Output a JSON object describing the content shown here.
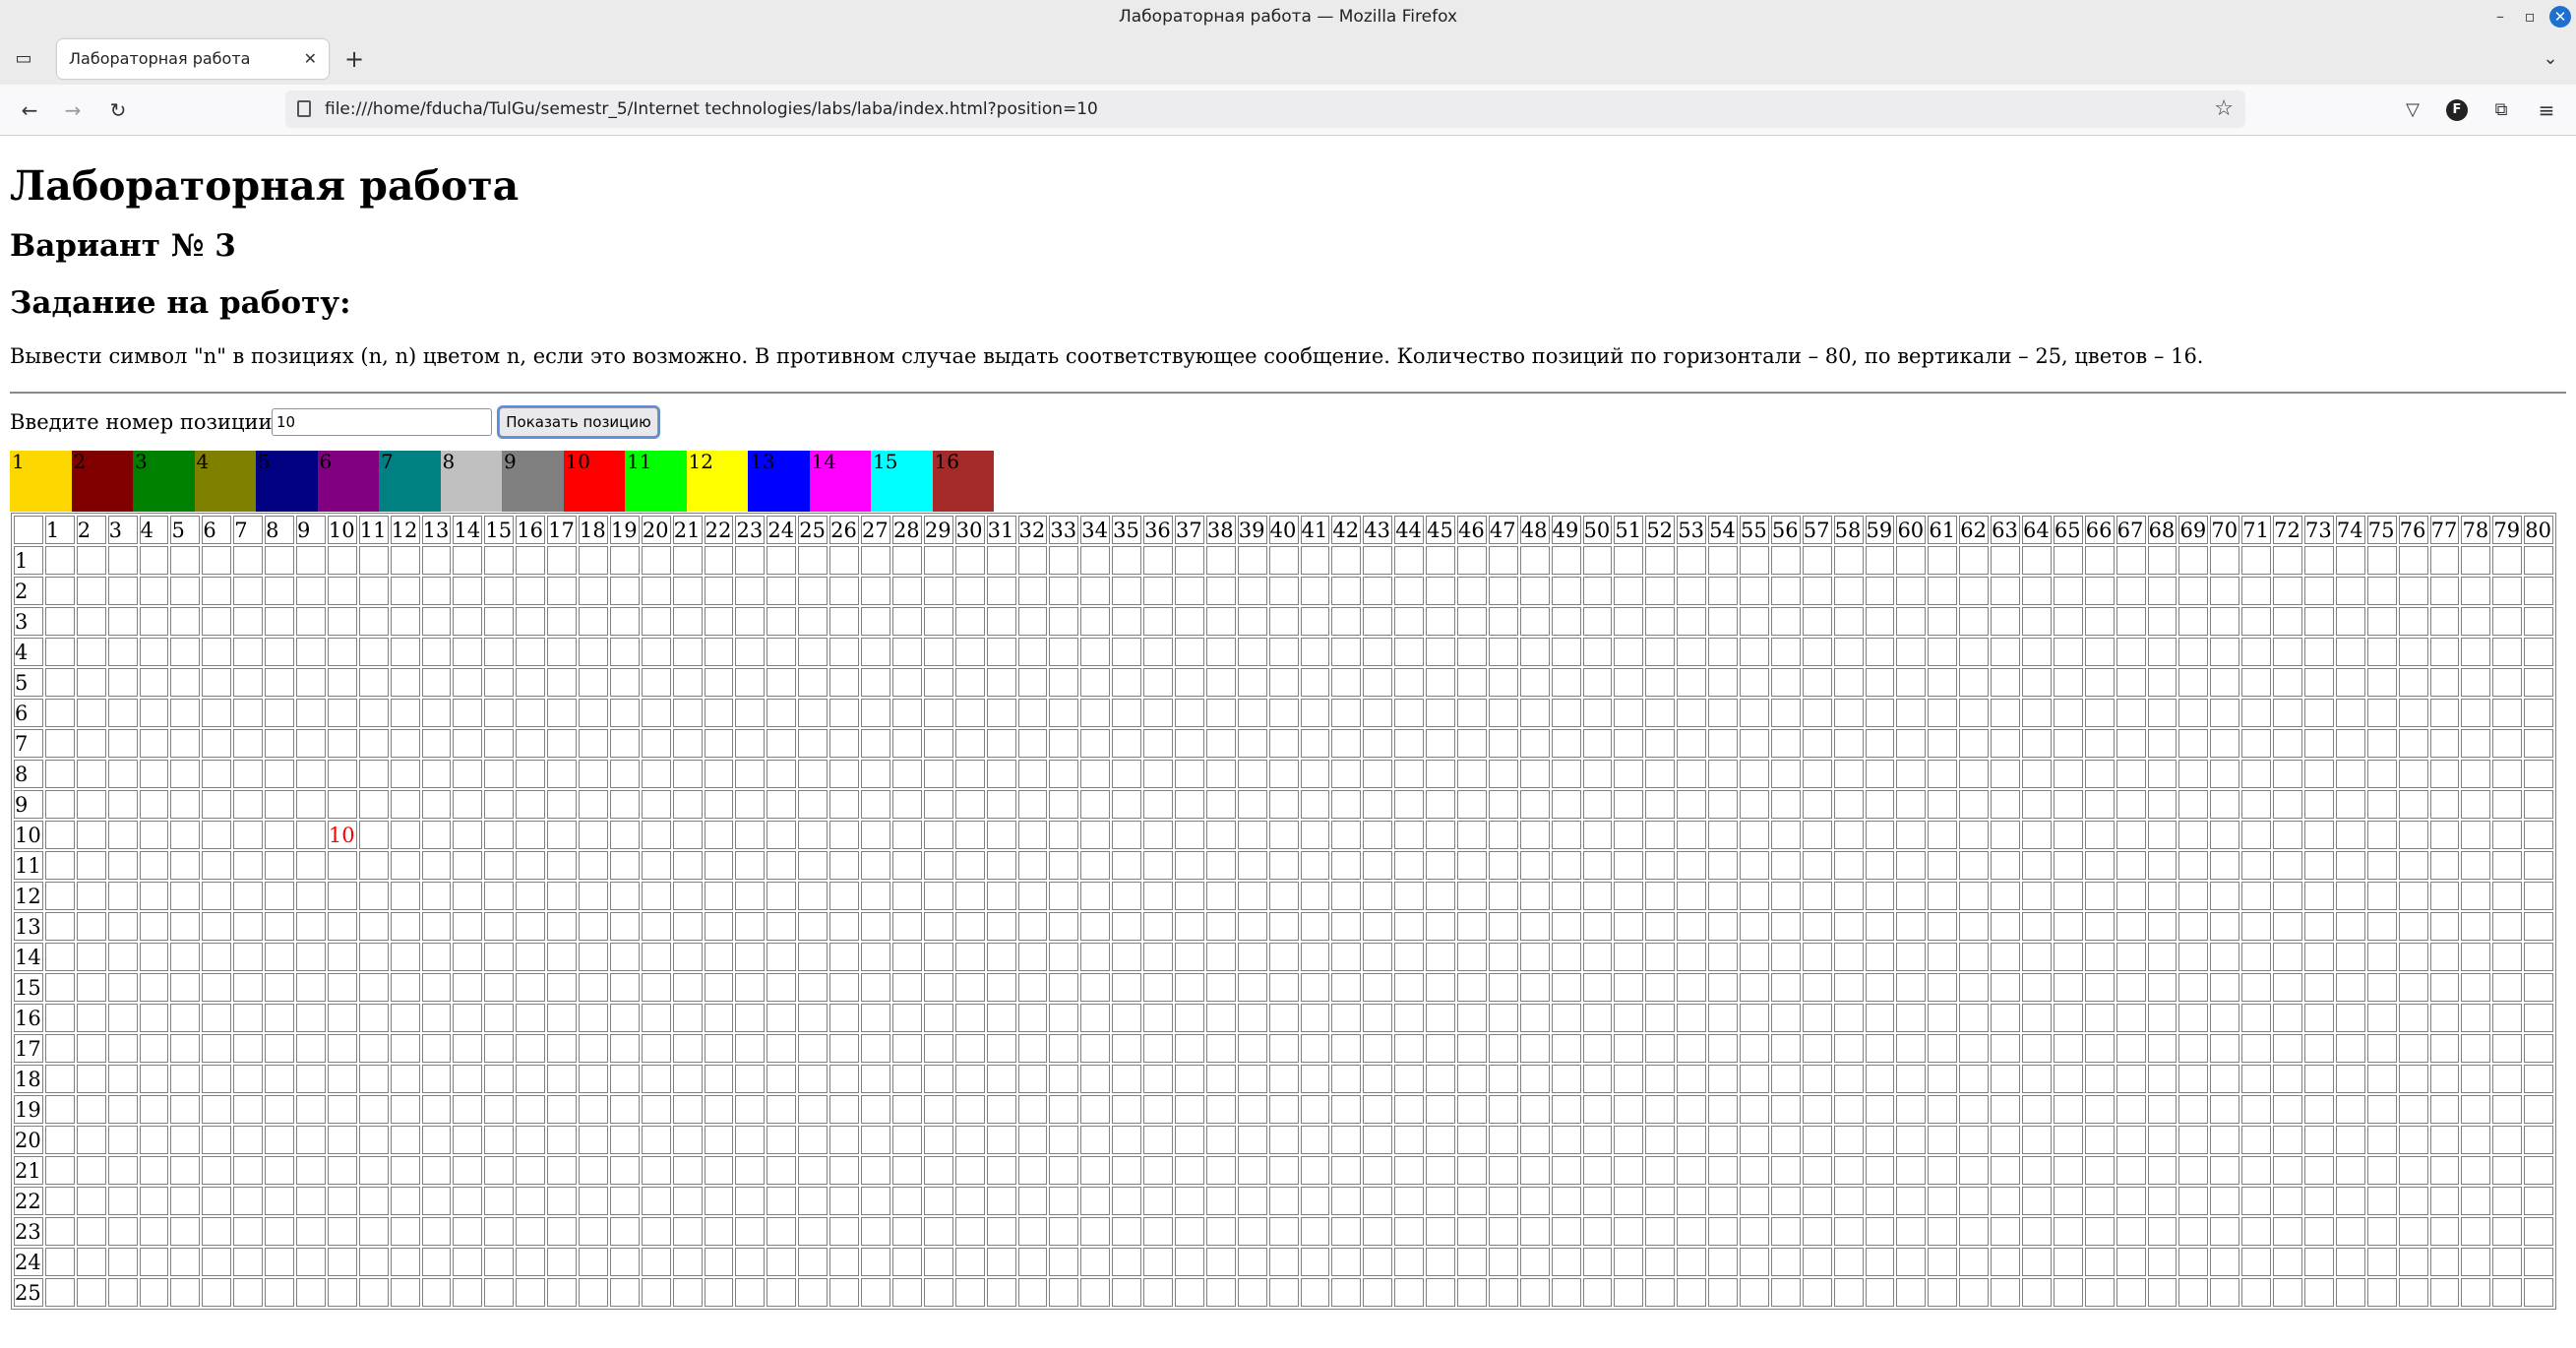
{
  "window": {
    "title": "Лабораторная работа — Mozilla Firefox"
  },
  "tab": {
    "label": "Лабораторная работа"
  },
  "address": {
    "url": "file:///home/fducha/TulGu/semestr_5/Internet technologies/labs/laba/index.html?position=10"
  },
  "icons": {
    "tab_list": "tab-list-icon",
    "new_tab": "plus-icon",
    "back": "arrow-left-icon",
    "forward": "arrow-right-icon",
    "reload": "reload-icon",
    "bookmark": "star-icon",
    "pocket": "pocket-icon",
    "account": "account-icon",
    "extensions": "puzzle-icon",
    "menu": "hamburger-menu-icon"
  },
  "account_initial": "F",
  "page": {
    "title": "Лабораторная работа",
    "variant": "Вариант № 3",
    "task_heading": "Задание на работу:",
    "task_text": "Вывести символ \"n\" в позициях (n, n) цветом n, если это возможно. В противном случае выдать соответствующее сообщение. Количество позиций по горизонтали – 80, по вертикали – 25, цветов – 16.",
    "input_label": "Введите номер позиции:",
    "input_value": "10",
    "button_label": "Показать позицию"
  },
  "palette": [
    {
      "label": "1",
      "color": "#ffd700"
    },
    {
      "label": "2",
      "color": "#800000"
    },
    {
      "label": "3",
      "color": "#008000"
    },
    {
      "label": "4",
      "color": "#808000"
    },
    {
      "label": "5",
      "color": "#000080"
    },
    {
      "label": "6",
      "color": "#800080"
    },
    {
      "label": "7",
      "color": "#008080"
    },
    {
      "label": "8",
      "color": "#c0c0c0"
    },
    {
      "label": "9",
      "color": "#808080"
    },
    {
      "label": "10",
      "color": "#ff0000"
    },
    {
      "label": "11",
      "color": "#00ff00"
    },
    {
      "label": "12",
      "color": "#ffff00"
    },
    {
      "label": "13",
      "color": "#0000ff"
    },
    {
      "label": "14",
      "color": "#ff00ff"
    },
    {
      "label": "15",
      "color": "#00ffff"
    },
    {
      "label": "16",
      "color": "#a52a2a"
    }
  ],
  "grid": {
    "columns": 80,
    "rows": 25,
    "marked_row": 10,
    "marked_col": 10,
    "marked_text": "10",
    "marked_color": "#ff0000"
  }
}
